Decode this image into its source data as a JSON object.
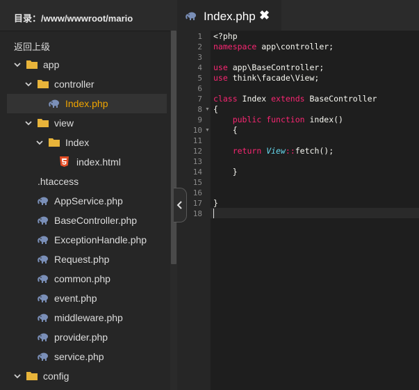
{
  "sidebar": {
    "title": "目录：/www/wwwroot/mario",
    "back_label": "返回上级",
    "tree": [
      {
        "label": "app",
        "type": "folder",
        "expanded": true,
        "depth": 0
      },
      {
        "label": "controller",
        "type": "folder",
        "expanded": true,
        "depth": 1
      },
      {
        "label": "Index.php",
        "type": "php",
        "depth": 2,
        "selected": true
      },
      {
        "label": "view",
        "type": "folder",
        "expanded": true,
        "depth": 1
      },
      {
        "label": "Index",
        "type": "folder",
        "expanded": true,
        "depth": 2
      },
      {
        "label": "index.html",
        "type": "html",
        "depth": 3
      },
      {
        "label": ".htaccess",
        "type": "file",
        "depth": 1
      },
      {
        "label": "AppService.php",
        "type": "php",
        "depth": 1
      },
      {
        "label": "BaseController.php",
        "type": "php",
        "depth": 1
      },
      {
        "label": "ExceptionHandle.php",
        "type": "php",
        "depth": 1
      },
      {
        "label": "Request.php",
        "type": "php",
        "depth": 1
      },
      {
        "label": "common.php",
        "type": "php",
        "depth": 1
      },
      {
        "label": "event.php",
        "type": "php",
        "depth": 1
      },
      {
        "label": "middleware.php",
        "type": "php",
        "depth": 1
      },
      {
        "label": "provider.php",
        "type": "php",
        "depth": 1
      },
      {
        "label": "service.php",
        "type": "php",
        "depth": 1
      },
      {
        "label": "config",
        "type": "folder",
        "expanded": true,
        "depth": 0
      }
    ]
  },
  "editor": {
    "tab": {
      "label": "Index.php",
      "close_glyph": "✖"
    },
    "line_numbers": [
      "1",
      "2",
      "3",
      "4",
      "5",
      "6",
      "7",
      "8",
      "9",
      "10",
      "11",
      "12",
      "13",
      "14",
      "15",
      "16",
      "17",
      "18"
    ],
    "fold_markers": {
      "8": "▼",
      "10": "▼"
    },
    "code": [
      [
        {
          "t": "<?php",
          "c": "plain"
        }
      ],
      [
        {
          "t": "namespace",
          "c": "kw"
        },
        {
          "t": " app\\controller;",
          "c": "plain"
        }
      ],
      [],
      [
        {
          "t": "use",
          "c": "kw"
        },
        {
          "t": " app\\BaseController;",
          "c": "plain"
        }
      ],
      [
        {
          "t": "use",
          "c": "kw"
        },
        {
          "t": " think\\facade\\View;",
          "c": "plain"
        }
      ],
      [],
      [
        {
          "t": "class",
          "c": "kw"
        },
        {
          "t": " Index ",
          "c": "plain"
        },
        {
          "t": "extends",
          "c": "kw"
        },
        {
          "t": " BaseController",
          "c": "plain"
        }
      ],
      [
        {
          "t": "{",
          "c": "plain"
        }
      ],
      [
        {
          "t": "    ",
          "c": "plain"
        },
        {
          "t": "public",
          "c": "kw"
        },
        {
          "t": " ",
          "c": "plain"
        },
        {
          "t": "function",
          "c": "kw"
        },
        {
          "t": " index()",
          "c": "plain"
        }
      ],
      [
        {
          "t": "    {",
          "c": "plain"
        }
      ],
      [],
      [
        {
          "t": "    ",
          "c": "plain"
        },
        {
          "t": "return",
          "c": "kw"
        },
        {
          "t": " ",
          "c": "plain"
        },
        {
          "t": "View",
          "c": "cls"
        },
        {
          "t": "::",
          "c": "op"
        },
        {
          "t": "fetch();",
          "c": "plain"
        }
      ],
      [],
      [
        {
          "t": "    }",
          "c": "plain"
        }
      ],
      [],
      [],
      [
        {
          "t": "}",
          "c": "plain"
        }
      ],
      []
    ]
  },
  "colors": {
    "keyword": "#f92672",
    "class_ref": "#66d9ef",
    "operator": "#f92672",
    "plain": "#f8f8f2",
    "folder": "#e8b43a",
    "php_icon": "#7a8fb8",
    "html_icon": "#e44d26",
    "selected_text": "#f0a500"
  },
  "icons": {
    "folder": "folder-icon",
    "php": "php-elephant-icon",
    "html": "html5-icon",
    "expanded": "chevron-down-icon",
    "collapse_panel": "chevron-left-icon",
    "close": "close-icon"
  }
}
